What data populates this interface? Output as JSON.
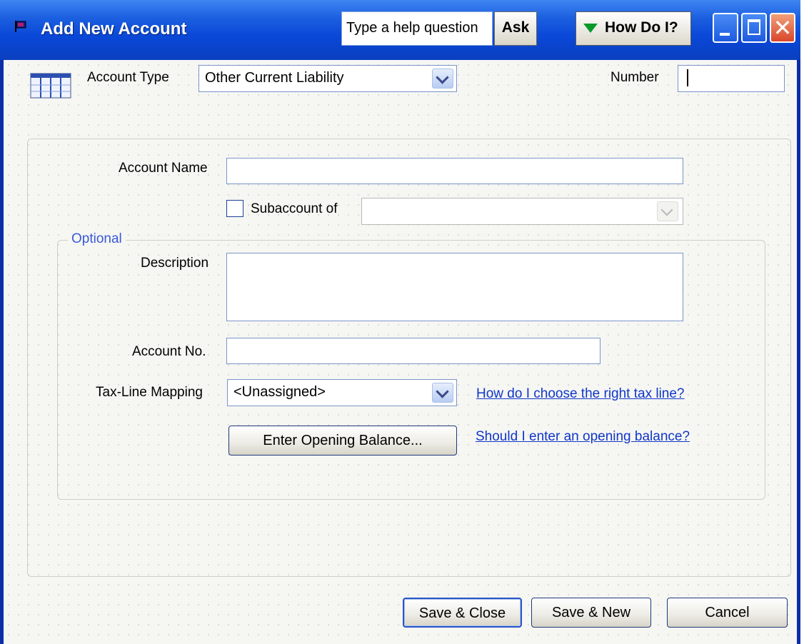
{
  "window": {
    "title": "Add New Account",
    "help_placeholder": "Type a help question",
    "ask_label": "Ask",
    "howdoi_label": "How Do I?"
  },
  "form": {
    "account_type_label": "Account Type",
    "account_type_value": "Other Current Liability",
    "number_label": "Number",
    "number_value": "",
    "account_name_label": "Account Name",
    "account_name_value": "",
    "subaccount_label": "Subaccount of",
    "subaccount_checked": false,
    "subaccount_value": "",
    "optional_label": "Optional",
    "description_label": "Description",
    "description_value": "",
    "account_no_label": "Account No.",
    "account_no_value": "",
    "tax_line_label": "Tax-Line Mapping",
    "tax_line_value": "<Unassigned>",
    "tax_line_help_link": "How do I choose the right tax line?",
    "opening_balance_button": "Enter Opening Balance...",
    "opening_balance_help_link": "Should I enter an opening balance?"
  },
  "footer": {
    "save_close": "Save & Close",
    "save_new": "Save & New",
    "cancel": "Cancel"
  },
  "colors": {
    "titlebar": "#0a48d8",
    "link": "#1037c8",
    "optional_legend": "#3a5ad8"
  }
}
